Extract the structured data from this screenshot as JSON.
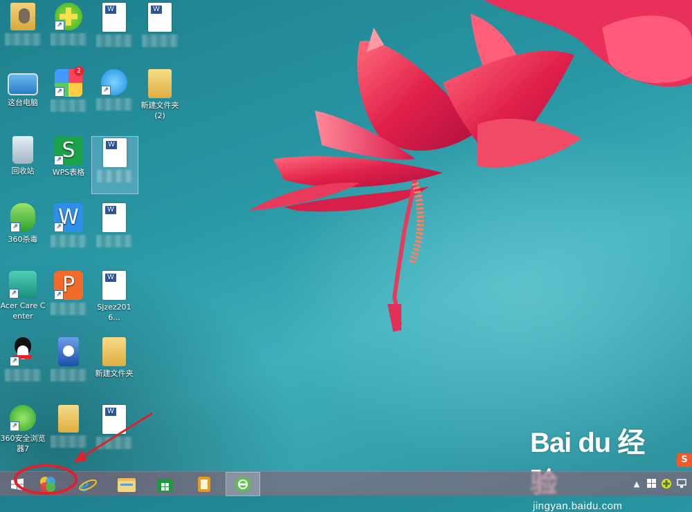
{
  "desktop": {
    "icons": [
      {
        "label": "",
        "name": "user-folder"
      },
      {
        "label": "",
        "name": "360-safe"
      },
      {
        "label": "",
        "name": "word-doc-1"
      },
      {
        "label": "",
        "name": "word-doc-2"
      },
      {
        "label": "这台电脑",
        "name": "this-pc"
      },
      {
        "label": "",
        "name": "app-store-360",
        "badge": "2"
      },
      {
        "label": "",
        "name": "qq-browser"
      },
      {
        "label": "新建文件夹\n(2)",
        "name": "new-folder-2"
      },
      {
        "label": "回收站",
        "name": "recycle-bin"
      },
      {
        "label": "WPS表格",
        "name": "wps-spreadsheet"
      },
      {
        "label": "",
        "name": "word-doc-selected"
      },
      {
        "label": "360杀毒",
        "name": "360-antivirus"
      },
      {
        "label": "",
        "name": "wps-writer"
      },
      {
        "label": "",
        "name": "word-doc-3"
      },
      {
        "label": "Acer Care Center",
        "name": "acer-care-center"
      },
      {
        "label": "",
        "name": "wps-presentation"
      },
      {
        "label": "Sjzez2016...",
        "name": "word-doc-sjzez"
      },
      {
        "label": "",
        "name": "qq"
      },
      {
        "label": "",
        "name": "basketball-app"
      },
      {
        "label": "新建文件夹",
        "name": "new-folder"
      },
      {
        "label": "360安全浏览器7",
        "name": "360-browser"
      },
      {
        "label": "",
        "name": "folder-docs"
      },
      {
        "label": "",
        "name": "word-doc-4"
      }
    ]
  },
  "taskbar": {
    "items": [
      {
        "name": "start",
        "icon": "windows-logo-icon"
      },
      {
        "name": "app-launcher",
        "icon": "colorful-app-icon"
      },
      {
        "name": "internet-explorer",
        "icon": "ie-icon"
      },
      {
        "name": "file-explorer",
        "icon": "folder-icon"
      },
      {
        "name": "store",
        "icon": "store-icon"
      },
      {
        "name": "notes-app",
        "icon": "notes-icon"
      },
      {
        "name": "360-browser",
        "icon": "green-browser-icon"
      }
    ]
  },
  "watermark": {
    "brand": "Bai du 经验",
    "sub": "jingyan.baidu.com"
  },
  "colors": {
    "accent_annotation": "#e0202a",
    "taskbar": "#9a5a6e"
  }
}
